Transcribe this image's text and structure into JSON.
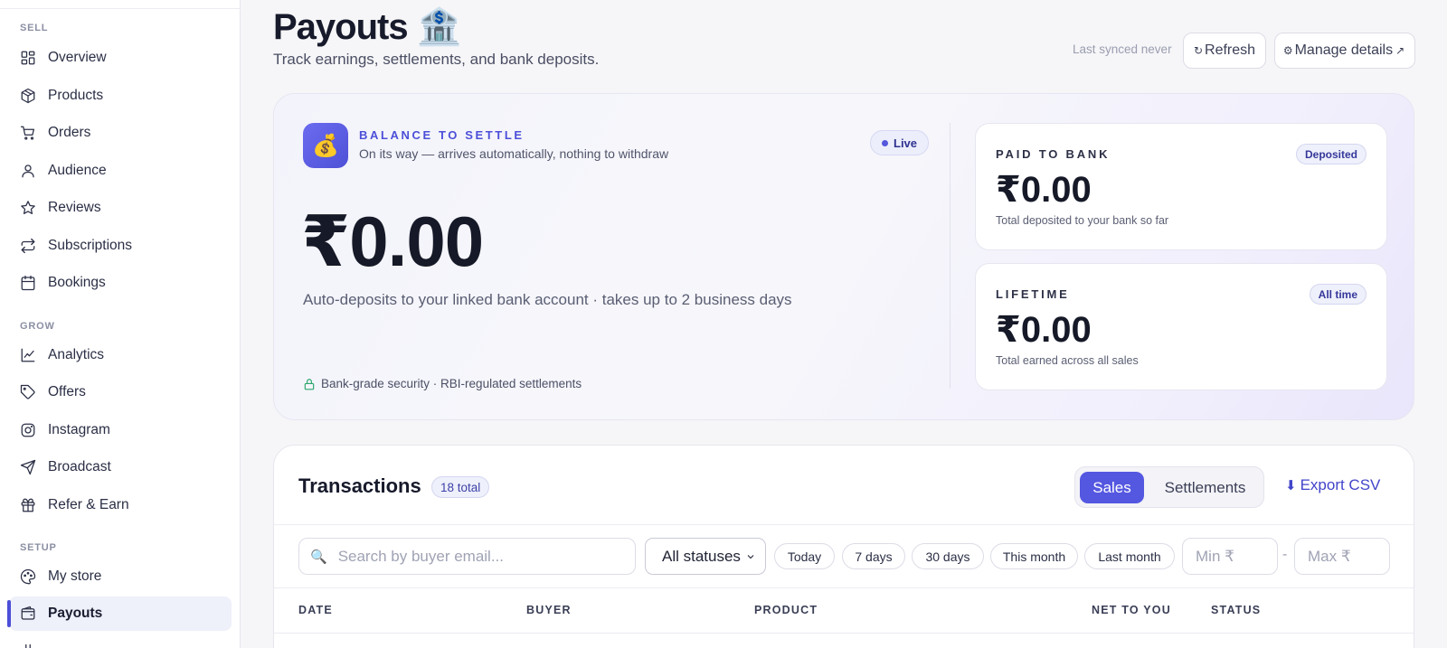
{
  "sidebar": {
    "sections": [
      {
        "label": "SELL",
        "items": [
          "Overview",
          "Products",
          "Orders",
          "Audience",
          "Reviews",
          "Subscriptions",
          "Bookings"
        ]
      },
      {
        "label": "GROW",
        "items": [
          "Analytics",
          "Offers",
          "Instagram",
          "Broadcast",
          "Refer & Earn"
        ]
      },
      {
        "label": "SETUP",
        "items": [
          "My store",
          "Payouts"
        ]
      }
    ],
    "sell_label": "SELL",
    "grow_label": "GROW",
    "setup_label": "SETUP",
    "overview": "Overview",
    "products": "Products",
    "orders": "Orders",
    "audience": "Audience",
    "reviews": "Reviews",
    "subscriptions": "Subscriptions",
    "bookings": "Bookings",
    "analytics": "Analytics",
    "offers": "Offers",
    "instagram": "Instagram",
    "broadcast": "Broadcast",
    "refer": "Refer & Earn",
    "my_store": "My store",
    "payouts": "Payouts",
    "active_item": "Payouts"
  },
  "header": {
    "title": "Payouts 🏦",
    "subtitle": "Track earnings, settlements, and bank deposits.",
    "last_synced": "Last synced never",
    "refresh_icon": "↻",
    "refresh_label": "Refresh",
    "manage_icon": "⚙",
    "manage_label": "Manage details",
    "manage_ext": "↗"
  },
  "balance": {
    "icon": "💰",
    "heading": "BALANCE TO SETTLE",
    "description": "On its way — arrives automatically, nothing to withdraw",
    "live_label": "Live",
    "amount": "₹0.00",
    "note": "Auto-deposits to your linked bank account · takes up to 2 business days",
    "security": "Bank-grade security · RBI-regulated settlements"
  },
  "paid_to_bank": {
    "label": "PAID TO BANK",
    "badge": "Deposited",
    "amount": "₹0.00",
    "description": "Total deposited to your bank so far"
  },
  "lifetime": {
    "label": "LIFETIME",
    "badge": "All time",
    "amount": "₹0.00",
    "description": "Total earned across all sales"
  },
  "transactions": {
    "title": "Transactions",
    "count": "18 total",
    "tabs": [
      "Sales",
      "Settlements"
    ],
    "sales_tab": "Sales",
    "settlements_tab": "Settlements",
    "selected_tab": "Sales",
    "export_icon": "⬇",
    "export_label": "Export CSV",
    "search_placeholder": "Search by buyer email...",
    "status_value": "All statuses",
    "chips": [
      "Today",
      "7 days",
      "30 days",
      "This month",
      "Last month"
    ],
    "chip_today": "Today",
    "chip_7": "7 days",
    "chip_30": "30 days",
    "chip_month": "This month",
    "chip_last": "Last month",
    "min_placeholder": "Min ₹",
    "max_placeholder": "Max ₹",
    "range_sep": "-",
    "columns": [
      "DATE",
      "BUYER",
      "PRODUCT",
      "NET TO YOU",
      "STATUS"
    ],
    "col_date": "DATE",
    "col_buyer": "BUYER",
    "col_product": "PRODUCT",
    "col_net": "NET TO YOU",
    "col_status": "STATUS"
  },
  "colors": {
    "accent": "#5457e0",
    "active_bg": "#eef0fa",
    "security_icon": "#2aa56b"
  }
}
